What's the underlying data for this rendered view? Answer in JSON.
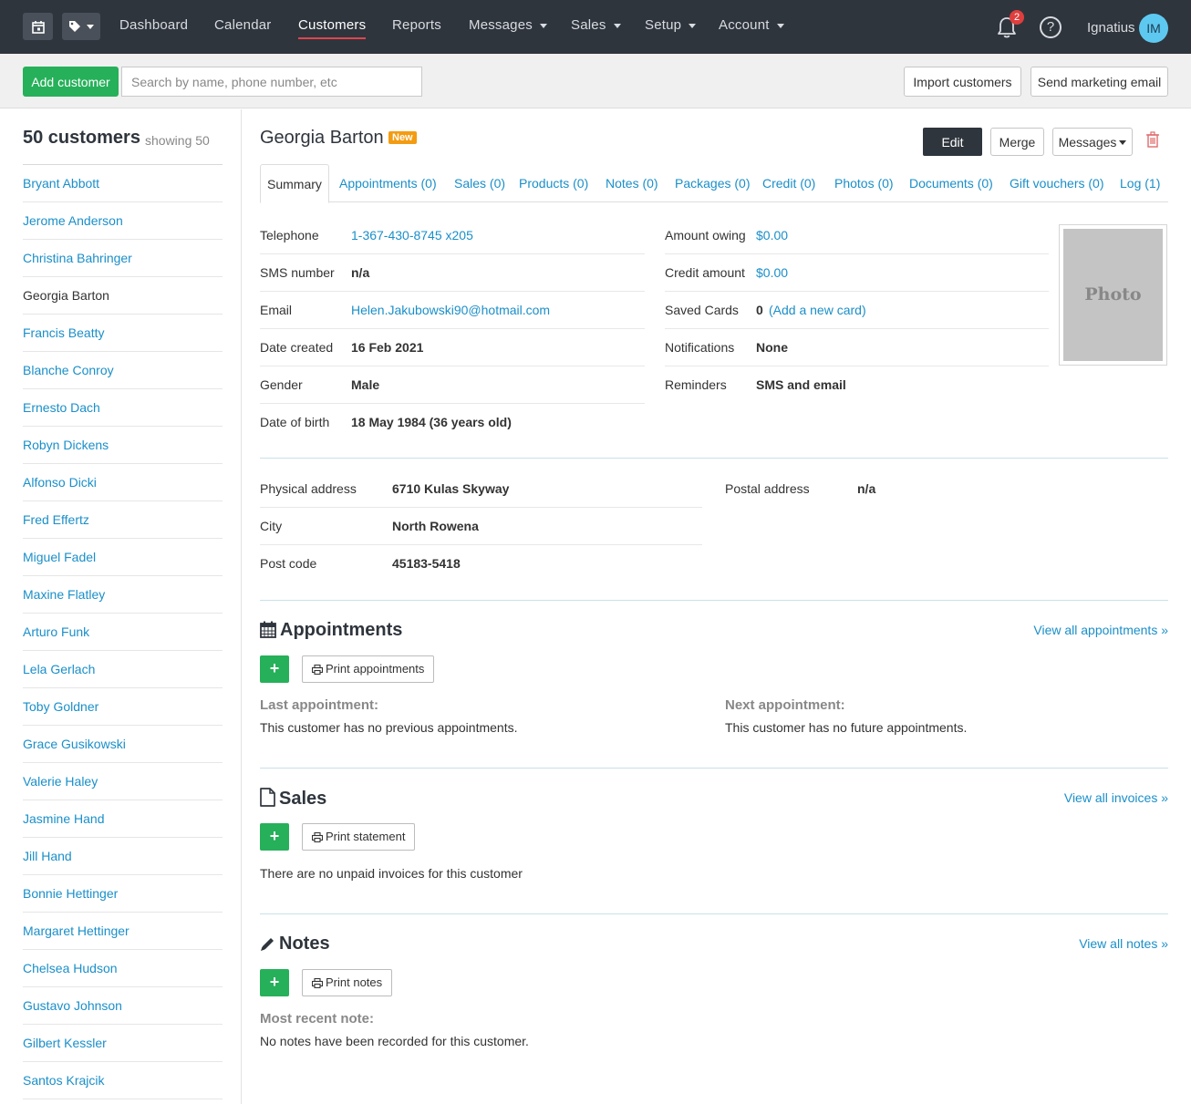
{
  "nav": {
    "items": [
      {
        "label": "Dashboard",
        "dropdown": false,
        "active": false
      },
      {
        "label": "Calendar",
        "dropdown": false,
        "active": false
      },
      {
        "label": "Customers",
        "dropdown": false,
        "active": true
      },
      {
        "label": "Reports",
        "dropdown": false,
        "active": false
      },
      {
        "label": "Messages",
        "dropdown": true,
        "active": false
      },
      {
        "label": "Sales",
        "dropdown": true,
        "active": false
      },
      {
        "label": "Setup",
        "dropdown": true,
        "active": false
      },
      {
        "label": "Account",
        "dropdown": true,
        "active": false
      }
    ],
    "notification_count": "2",
    "help_glyph": "?",
    "user_name": "Ignatius",
    "user_initials": "IM",
    "colors": {
      "bar": "#2f353d",
      "active_underline": "#e0454f",
      "avatar": "#5ec9f0"
    }
  },
  "toolbar": {
    "add_customer_label": "Add customer",
    "search_placeholder": "Search by name, phone number, etc",
    "import_label": "Import customers",
    "marketing_label": "Send marketing email",
    "accent_green": "#26b05a"
  },
  "sidebar": {
    "count": "50 customers",
    "showing": "showing 50",
    "customers": [
      "Bryant Abbott",
      "Jerome Anderson",
      "Christina Bahringer",
      "Georgia Barton",
      "Francis Beatty",
      "Blanche Conroy",
      "Ernesto Dach",
      "Robyn Dickens",
      "Alfonso Dicki",
      "Fred Effertz",
      "Miguel Fadel",
      "Maxine Flatley",
      "Arturo Funk",
      "Lela Gerlach",
      "Toby Goldner",
      "Grace Gusikowski",
      "Valerie Haley",
      "Jasmine Hand",
      "Jill Hand",
      "Bonnie Hettinger",
      "Margaret Hettinger",
      "Chelsea Hudson",
      "Gustavo Johnson",
      "Gilbert Kessler",
      "Santos Krajcik"
    ],
    "current": "Georgia Barton"
  },
  "customer": {
    "name": "Georgia Barton",
    "badge": "New",
    "edit_label": "Edit",
    "merge_label": "Merge",
    "messages_label": "Messages",
    "tabs": [
      "Summary",
      "Appointments (0)",
      "Sales (0)",
      "Products (0)",
      "Notes (0)",
      "Packages (0)",
      "Credit (0)",
      "Photos (0)",
      "Documents (0)",
      "Gift vouchers (0)",
      "Log (1)"
    ],
    "details_left": [
      {
        "label": "Telephone",
        "value": "1-367-430-8745 x205",
        "link": true
      },
      {
        "label": "SMS number",
        "value": "n/a",
        "link": false
      },
      {
        "label": "Email",
        "value": "Helen.Jakubowski90@hotmail.com",
        "link": true
      },
      {
        "label": "Date created",
        "value": "16 Feb 2021",
        "link": false
      },
      {
        "label": "Gender",
        "value": "Male",
        "link": false
      },
      {
        "label": "Date of birth",
        "value": "18 May 1984 (36 years old)",
        "link": false
      }
    ],
    "details_right": [
      {
        "label": "Amount owing",
        "value": "$0.00",
        "link": true
      },
      {
        "label": "Credit amount",
        "value": "$0.00",
        "link": true
      },
      {
        "label": "Saved Cards",
        "value": "0",
        "extra": "(Add a new card)",
        "link": false
      },
      {
        "label": "Notifications",
        "value": "None",
        "link": false
      },
      {
        "label": "Reminders",
        "value": "SMS and email",
        "link": false
      }
    ],
    "photo_label": "Photo",
    "address": [
      {
        "label": "Physical address",
        "value": "6710 Kulas Skyway"
      },
      {
        "label": "City",
        "value": "North Rowena"
      },
      {
        "label": "Post code",
        "value": "45183-5418"
      }
    ],
    "postal": {
      "label": "Postal address",
      "value": "n/a"
    }
  },
  "appointments": {
    "title": "Appointments",
    "view_all": "View all appointments »",
    "plus": "+",
    "print_label": "Print appointments",
    "last_head": "Last appointment:",
    "last_text": "This customer has no previous appointments.",
    "next_head": "Next appointment:",
    "next_text": "This customer has no future appointments."
  },
  "sales": {
    "title": "Sales",
    "view_all": "View all invoices »",
    "plus": "+",
    "print_label": "Print statement",
    "text": "There are no unpaid invoices for this customer"
  },
  "notes": {
    "title": "Notes",
    "view_all": "View all notes »",
    "plus": "+",
    "print_label": "Print notes",
    "recent_head": "Most recent note:",
    "recent_text": "No notes have been recorded for this customer."
  }
}
